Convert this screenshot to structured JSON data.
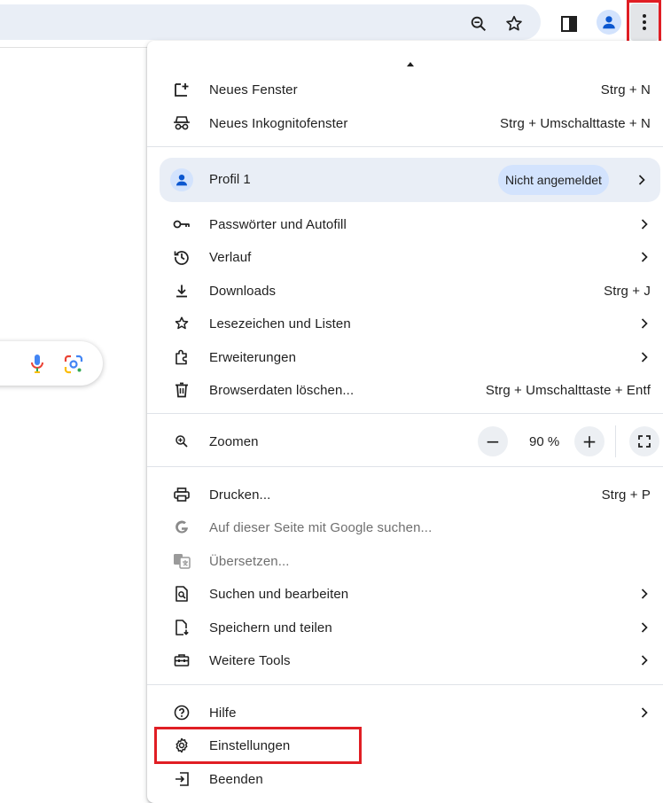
{
  "toolbar": {
    "icons": [
      "zoom-icon",
      "star-icon",
      "side-panel-icon",
      "profile-icon",
      "more-menu-icon"
    ]
  },
  "menu": {
    "new_window": {
      "label": "Neues Fenster",
      "shortcut": "Strg + N"
    },
    "incognito": {
      "label": "Neues Inkognitofenster",
      "shortcut": "Strg + Umschalttaste + N"
    },
    "profile": {
      "label": "Profil 1",
      "status": "Nicht angemeldet"
    },
    "passwords": {
      "label": "Passwörter und Autofill"
    },
    "history": {
      "label": "Verlauf"
    },
    "downloads": {
      "label": "Downloads",
      "shortcut": "Strg + J"
    },
    "bookmarks": {
      "label": "Lesezeichen und Listen"
    },
    "extensions": {
      "label": "Erweiterungen"
    },
    "clear_data": {
      "label": "Browserdaten löschen...",
      "shortcut": "Strg + Umschalttaste + Entf"
    },
    "zoom": {
      "label": "Zoomen",
      "minus": "−",
      "plus": "+",
      "value": "90 %"
    },
    "print": {
      "label": "Drucken...",
      "shortcut": "Strg + P"
    },
    "google_search": {
      "label": "Auf dieser Seite mit Google suchen..."
    },
    "translate": {
      "label": "Übersetzen..."
    },
    "find_edit": {
      "label": "Suchen und bearbeiten"
    },
    "save_share": {
      "label": "Speichern und teilen"
    },
    "more_tools": {
      "label": "Weitere Tools"
    },
    "help": {
      "label": "Hilfe"
    },
    "settings": {
      "label": "Einstellungen"
    },
    "exit": {
      "label": "Beenden"
    }
  },
  "colors": {
    "highlight": "#e01e24",
    "omnibox_bg": "#e9eef6",
    "profile_badge_bg": "#d3e3fd",
    "accent_blue": "#0b57d0"
  }
}
